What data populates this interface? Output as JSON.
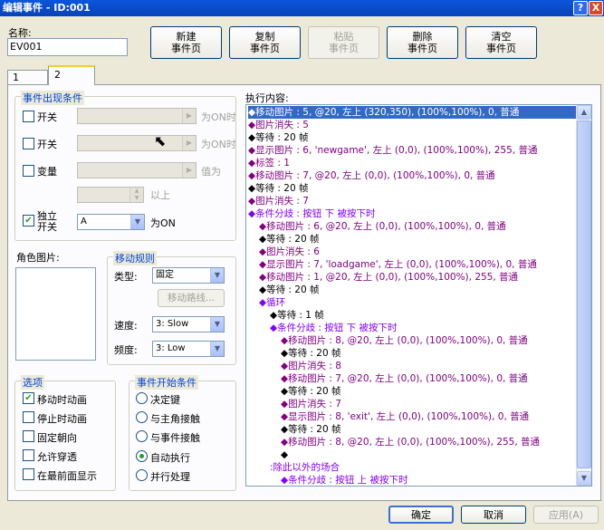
{
  "window": {
    "title": "编辑事件 - ID:001",
    "help": "?",
    "close": "X"
  },
  "name_label": "名称:",
  "name_value": "EV001",
  "toolbar": {
    "new_page": [
      "新建",
      "事件页"
    ],
    "copy_page": [
      "复制",
      "事件页"
    ],
    "paste_page": [
      "粘贴",
      "事件页"
    ],
    "delete_page": [
      "删除",
      "事件页"
    ],
    "clear_page": [
      "清空",
      "事件页"
    ]
  },
  "tabs": [
    "1",
    "2"
  ],
  "conditions": {
    "title": "事件出现条件",
    "switch1": {
      "label": "开关",
      "suffix": "为ON时",
      "checked": false
    },
    "switch2": {
      "label": "开关",
      "suffix": "为ON时",
      "checked": false
    },
    "variable": {
      "label": "变量",
      "suffix": "值为",
      "checked": false
    },
    "above": "以上",
    "self_switch": {
      "label1": "独立",
      "label2": "开关",
      "value": "A",
      "suffix": "为ON",
      "checked": true
    }
  },
  "graphic": {
    "title": "角色图片:"
  },
  "movement": {
    "title": "移动规则",
    "type_label": "类型:",
    "type_value": "固定",
    "route_button": "移动路线...",
    "speed_label": "速度:",
    "speed_value": "3: Slow",
    "freq_label": "频度:",
    "freq_value": "3: Low"
  },
  "options": {
    "title": "选项",
    "items": [
      {
        "label": "移动时动画",
        "checked": true
      },
      {
        "label": "停止时动画",
        "checked": false
      },
      {
        "label": "固定朝向",
        "checked": false
      },
      {
        "label": "允许穿透",
        "checked": false
      },
      {
        "label": "在最前面显示",
        "checked": false
      }
    ]
  },
  "trigger": {
    "title": "事件开始条件",
    "items": [
      {
        "label": "决定键",
        "selected": false
      },
      {
        "label": "与主角接触",
        "selected": false
      },
      {
        "label": "与事件接触",
        "selected": false
      },
      {
        "label": "自动执行",
        "selected": true
      },
      {
        "label": "并行处理",
        "selected": false
      }
    ]
  },
  "commands": {
    "title": "执行内容:",
    "lines": [
      {
        "indent": 0,
        "text": "◆移动图片 : 5, @20, 左上 (320,350), (100%,100%), 0, 普通",
        "color": "sel"
      },
      {
        "indent": 0,
        "text": "◆图片消失 : 5",
        "color": "purple"
      },
      {
        "indent": 0,
        "text": "◆等待 : 20 帧",
        "color": "black"
      },
      {
        "indent": 0,
        "text": "◆显示图片 : 6, 'newgame', 左上 (0,0), (100%,100%), 255, 普通",
        "color": "purple"
      },
      {
        "indent": 0,
        "text": "◆标签 : 1",
        "color": "purple"
      },
      {
        "indent": 0,
        "text": "◆移动图片 : 7, @20, 左上 (0,0), (100%,100%), 0, 普通",
        "color": "purple"
      },
      {
        "indent": 0,
        "text": "◆等待 : 20 帧",
        "color": "black"
      },
      {
        "indent": 0,
        "text": "◆图片消失 : 7",
        "color": "purple"
      },
      {
        "indent": 0,
        "text": "◆条件分歧 : 按钮 下 被按下时",
        "color": "blue"
      },
      {
        "indent": 1,
        "text": "◆移动图片 : 6, @20, 左上 (0,0), (100%,100%), 0, 普通",
        "color": "purple"
      },
      {
        "indent": 1,
        "text": "◆等待 : 20 帧",
        "color": "black"
      },
      {
        "indent": 1,
        "text": "◆图片消失 : 6",
        "color": "purple"
      },
      {
        "indent": 1,
        "text": "◆显示图片 : 7, 'loadgame', 左上 (0,0), (100%,100%), 0, 普通",
        "color": "purple"
      },
      {
        "indent": 1,
        "text": "◆移动图片 : 1, @20, 左上 (0,0), (100%,100%), 255, 普通",
        "color": "purple"
      },
      {
        "indent": 1,
        "text": "◆等待 : 20 帧",
        "color": "black"
      },
      {
        "indent": 1,
        "text": "◆循环",
        "color": "blue"
      },
      {
        "indent": 2,
        "text": "◆等待 : 1 帧",
        "color": "black"
      },
      {
        "indent": 2,
        "text": "◆条件分歧 : 按钮 下 被按下时",
        "color": "blue"
      },
      {
        "indent": 3,
        "text": "◆移动图片 : 8, @20, 左上 (0,0), (100%,100%), 0, 普通",
        "color": "purple"
      },
      {
        "indent": 3,
        "text": "◆等待 : 20 帧",
        "color": "black"
      },
      {
        "indent": 3,
        "text": "◆图片消失 : 8",
        "color": "purple"
      },
      {
        "indent": 3,
        "text": "◆移动图片 : 7, @20, 左上 (0,0), (100%,100%), 0, 普通",
        "color": "purple"
      },
      {
        "indent": 3,
        "text": "◆等待 : 20 帧",
        "color": "black"
      },
      {
        "indent": 3,
        "text": "◆图片消失 : 7",
        "color": "purple"
      },
      {
        "indent": 3,
        "text": "◆显示图片 : 8, 'exit', 左上 (0,0), (100%,100%), 0, 普通",
        "color": "purple"
      },
      {
        "indent": 3,
        "text": "◆等待 : 20 帧",
        "color": "black"
      },
      {
        "indent": 3,
        "text": "◆移动图片 : 8, @20, 左上 (0,0), (100%,100%), 255, 普通",
        "color": "purple"
      },
      {
        "indent": 3,
        "text": "◆",
        "color": "black"
      },
      {
        "indent": 2,
        "text": ":除此以外的场合",
        "color": "blue"
      },
      {
        "indent": 3,
        "text": "◆条件分歧 : 按钮 上 被按下时",
        "color": "blue"
      }
    ]
  },
  "footer": {
    "ok": "确定",
    "cancel": "取消",
    "apply": "应用(A)"
  },
  "colors": {
    "titlebar": "#0A56DC",
    "selection": "#316AC5",
    "command_purple": "#800080",
    "command_blue": "#8000FF",
    "face": "#ECE9D8"
  }
}
